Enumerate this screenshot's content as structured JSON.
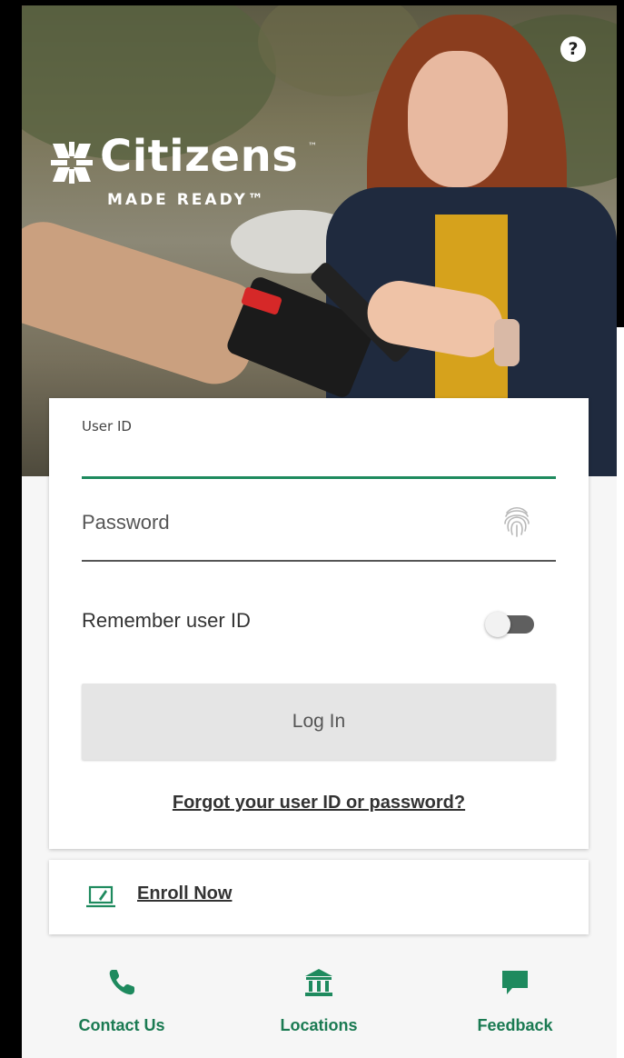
{
  "brand": {
    "name": "Citizens",
    "trademark": "™",
    "tagline": "MADE READY™",
    "accent_color": "#1e8a5e"
  },
  "header": {
    "help_label": "?"
  },
  "login_form": {
    "user_id": {
      "label": "User ID",
      "value": ""
    },
    "password": {
      "placeholder": "Password",
      "biometric_icon": "fingerprint-icon"
    },
    "remember": {
      "label": "Remember user ID",
      "enabled": false
    },
    "login_button_label": "Log In",
    "forgot_link_label": "Forgot your user ID or password?"
  },
  "enroll": {
    "icon": "laptop-icon",
    "label": "Enroll Now"
  },
  "bottom_nav": {
    "items": [
      {
        "label": "Contact Us",
        "icon": "phone-icon"
      },
      {
        "label": "Locations",
        "icon": "bank-icon"
      },
      {
        "label": "Feedback",
        "icon": "chat-icon"
      }
    ]
  }
}
